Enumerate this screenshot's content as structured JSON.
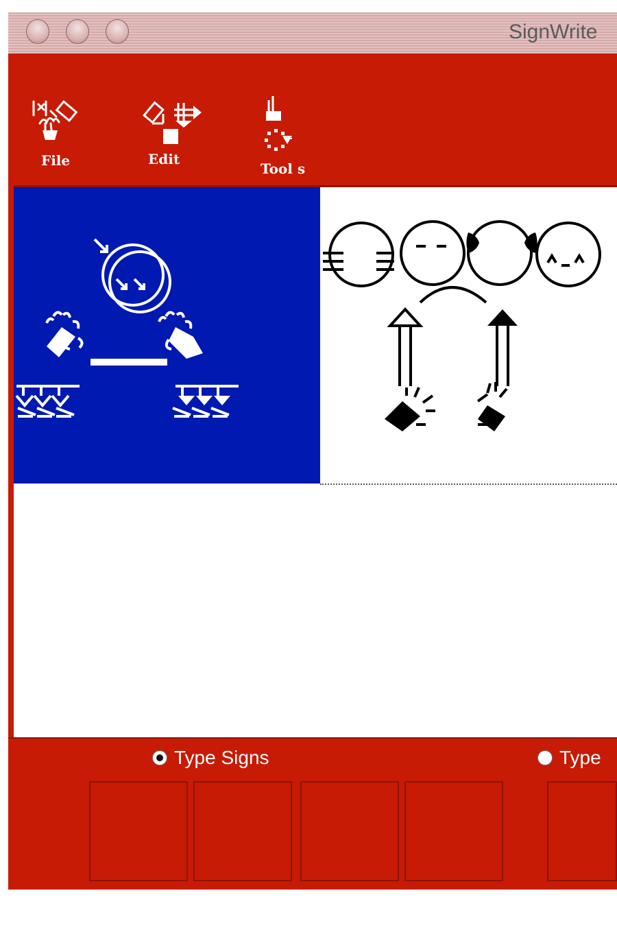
{
  "window": {
    "title": "SignWrite",
    "traffic_lights": [
      "close",
      "minimize",
      "zoom"
    ]
  },
  "toolbar": {
    "items": [
      {
        "label": "File",
        "icon": "file-hand-icon"
      },
      {
        "label": "Edit",
        "icon": "edit-hand-icon"
      },
      {
        "label": "Tool s",
        "icon": "tools-icon"
      }
    ]
  },
  "signs": [
    {
      "name": "sign-blue",
      "background": "#0019b0",
      "ink": "#ffffff",
      "selected": true
    },
    {
      "name": "sign-white",
      "background": "#ffffff",
      "ink": "#000000",
      "selected": false
    }
  ],
  "input_mode": {
    "options": [
      {
        "label": "Type Signs",
        "selected": true
      },
      {
        "label": "Type",
        "selected": false
      }
    ]
  },
  "palette": {
    "slot_count": 6
  },
  "colors": {
    "toolbar_red": "#c71b06",
    "selection_blue": "#0019b0"
  }
}
